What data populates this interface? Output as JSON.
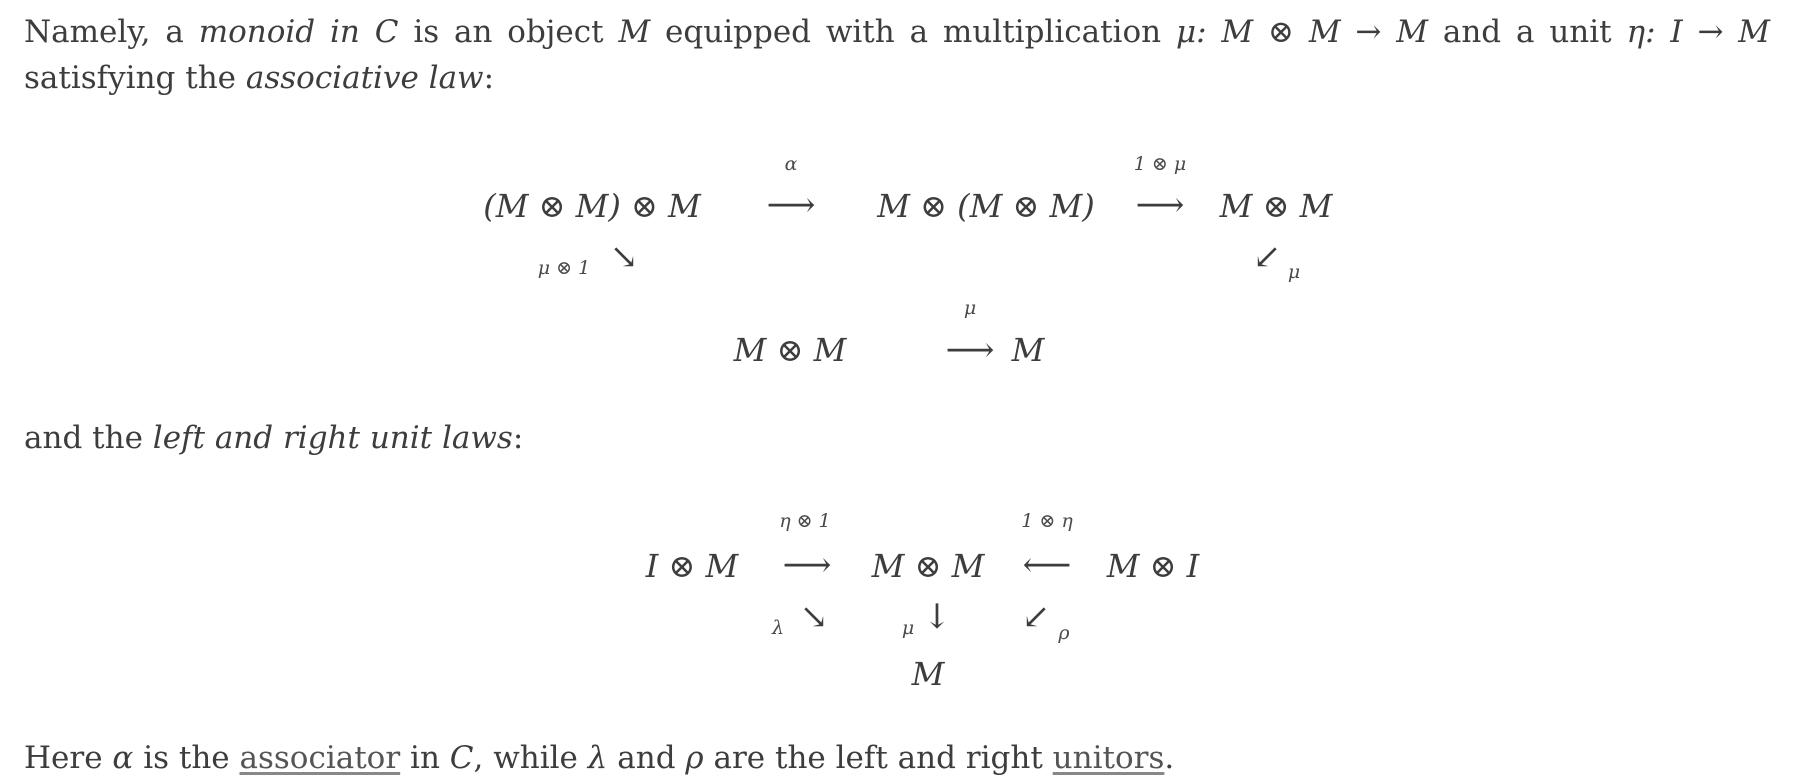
{
  "para1": {
    "t1": "Namely, a ",
    "em1": "monoid in",
    "C1": " C",
    "t2": " is an object ",
    "M1": "M",
    "t3": " equipped with a multiplication ",
    "mu_map": "μ: M ⊗ M → M",
    "t4": " and a unit ",
    "eta_map": "η: I → M"
  },
  "para2": {
    "t1": "satisfying the ",
    "em1": "associative law",
    "t2": ":"
  },
  "assoc": {
    "node_a": "(M ⊗ M) ⊗ M",
    "node_b": "M ⊗ (M ⊗ M)",
    "node_c": "M ⊗ M",
    "node_d": "M ⊗ M",
    "node_e": "M",
    "lab_alpha": "α",
    "lab_1mu": "1 ⊗ μ",
    "lab_mu1": "μ ⊗ 1",
    "lab_mu_right": "μ",
    "lab_mu_bottom": "μ",
    "arrow_right": "⟶",
    "arrow_se": "↘",
    "arrow_sw": "↙"
  },
  "para3": {
    "t1": "and the ",
    "em1": "left and right unit laws",
    "t2": ":"
  },
  "unit": {
    "node_a": "I ⊗ M",
    "node_b": "M ⊗ M",
    "node_c": "M ⊗ I",
    "node_d": "M",
    "lab_eta1": "η ⊗ 1",
    "lab_1eta": "1 ⊗ η",
    "lab_lambda": "λ",
    "lab_mu": "μ",
    "lab_rho": "ρ",
    "arrow_right": "⟶",
    "arrow_left": "⟵",
    "arrow_down": "↓",
    "arrow_se": "↘",
    "arrow_sw": "↙"
  },
  "para4": {
    "t1": "Here ",
    "alpha": "α",
    "t2": " is the ",
    "link1": "associator",
    "t3": " in ",
    "C": "C",
    "t4": ", while ",
    "lambda": "λ",
    "t5": " and ",
    "rho": "ρ",
    "t6": " are the left and right ",
    "link2": "unitors",
    "t7": "."
  }
}
